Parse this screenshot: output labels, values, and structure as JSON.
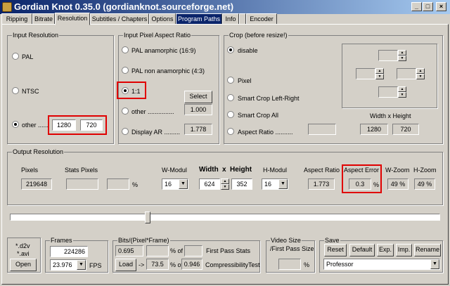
{
  "window": {
    "title": "Gordian Knot 0.35.0  (gordianknot.sourceforge.net)",
    "minimize": "_",
    "maximize": "□",
    "close": "×"
  },
  "tabs": [
    "Ripping",
    "Bitrate",
    "Resolution",
    "Subtitles / Chapters",
    "Options",
    "Program Paths",
    "Info",
    "",
    "Encoder"
  ],
  "input_resolution": {
    "title": "Input Resolution",
    "pal": "PAL",
    "ntsc": "NTSC",
    "other": "other ......",
    "width": "1280",
    "height": "720"
  },
  "par": {
    "title": "Input Pixel Aspect Ratio",
    "pal_ana": "PAL anamorphic (16:9)",
    "pal_non": "PAL non anamorphic (4:3)",
    "one": "1:1",
    "other": "other ...............",
    "display": "Display AR .........",
    "select": "Select",
    "other_value": "1.000",
    "display_value": "1.778"
  },
  "crop": {
    "title": "Crop (before resize!)",
    "disable": "disable",
    "pixel": "Pixel",
    "smart_lr": "Smart Crop Left-Right",
    "smart_all": "Smart Crop All",
    "aspect": "Aspect Ratio  ..........",
    "wh_label": "Width x Height",
    "width": "1280",
    "height": "720"
  },
  "output": {
    "title": "Output Resolution",
    "pixels_label": "Pixels",
    "pixels": "219648",
    "stats_label": "Stats Pixels",
    "pct": "%",
    "wmodul_label": "W-Modul",
    "wmodul": "16",
    "width_label": "Width",
    "x": "x",
    "height_label": "Height",
    "width": "624",
    "height": "352",
    "hmodul_label": "H-Modul",
    "hmodul": "16",
    "ar_label": "Aspect Ratio",
    "ar": "1.773",
    "err_label": "Aspect Error",
    "err": "0.3",
    "err_pct": "%",
    "wzoom_label": "W-Zoom",
    "wzoom": "49 %",
    "hzoom_label": "H-Zoom",
    "hzoom": "49 %"
  },
  "source": {
    "d2v": "*.d2v",
    "avi": "*.avi",
    "open": "Open"
  },
  "frames": {
    "title": "Frames",
    "count": "224286",
    "fps": "23.976",
    "fps_label": "FPS"
  },
  "bits": {
    "title": "Bits/(Pixel*Frame)",
    "value": "0.695",
    "pct_of": "% of",
    "first_pass": "First Pass Stats",
    "load": "Load",
    "arrow": "->",
    "comp_pct": "73.5",
    "comp_of": "% of",
    "comp_value": "0.946",
    "comp_label": "CompressibilityTest"
  },
  "video_size": {
    "title1": "Video Size",
    "title2": "/First Pass Size",
    "pct": "%"
  },
  "save": {
    "title": "Save",
    "reset": "Reset",
    "default": "Default",
    "exp": "Exp.",
    "imp": "Imp.",
    "rename": "Rename",
    "profile": "Professor"
  }
}
